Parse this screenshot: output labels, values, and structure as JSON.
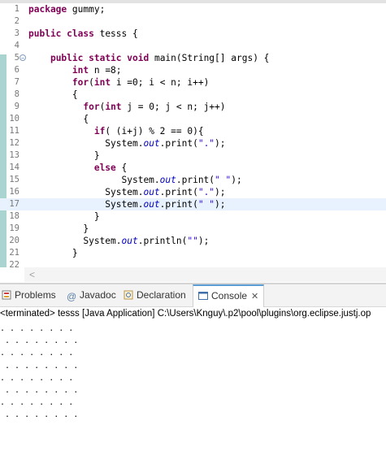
{
  "editor": {
    "lines": [
      {
        "n": "1",
        "segments": [
          {
            "t": "package ",
            "c": "kw"
          },
          {
            "t": "gummy;",
            "c": "id"
          }
        ]
      },
      {
        "n": "2",
        "segments": []
      },
      {
        "n": "3",
        "segments": [
          {
            "t": "public ",
            "c": "kw"
          },
          {
            "t": "class ",
            "c": "kw"
          },
          {
            "t": "tesss {",
            "c": "id"
          }
        ]
      },
      {
        "n": "4",
        "segments": []
      },
      {
        "n": "5",
        "fold": true,
        "segments": [
          {
            "t": "    ",
            "c": "id"
          },
          {
            "t": "public ",
            "c": "kw"
          },
          {
            "t": "static ",
            "c": "kw"
          },
          {
            "t": "void ",
            "c": "kw"
          },
          {
            "t": "main(String[] args) {",
            "c": "id"
          }
        ]
      },
      {
        "n": "6",
        "segments": [
          {
            "t": "        ",
            "c": "id"
          },
          {
            "t": "int ",
            "c": "kw"
          },
          {
            "t": "n =8;",
            "c": "id"
          }
        ]
      },
      {
        "n": "7",
        "segments": [
          {
            "t": "        ",
            "c": "id"
          },
          {
            "t": "for",
            "c": "kw"
          },
          {
            "t": "(",
            "c": "id"
          },
          {
            "t": "int ",
            "c": "kw"
          },
          {
            "t": "i =0; i < n; i++)",
            "c": "id"
          }
        ]
      },
      {
        "n": "8",
        "segments": [
          {
            "t": "        {",
            "c": "id"
          }
        ]
      },
      {
        "n": "9",
        "segments": [
          {
            "t": "          ",
            "c": "id"
          },
          {
            "t": "for",
            "c": "kw"
          },
          {
            "t": "(",
            "c": "id"
          },
          {
            "t": "int ",
            "c": "kw"
          },
          {
            "t": "j = 0; j < n; j++)",
            "c": "id"
          }
        ]
      },
      {
        "n": "10",
        "segments": [
          {
            "t": "          {",
            "c": "id"
          }
        ]
      },
      {
        "n": "11",
        "segments": [
          {
            "t": "            ",
            "c": "id"
          },
          {
            "t": "if",
            "c": "kw"
          },
          {
            "t": "( (i+j) % 2 == 0){",
            "c": "id"
          }
        ]
      },
      {
        "n": "12",
        "segments": [
          {
            "t": "              System.",
            "c": "id"
          },
          {
            "t": "out",
            "c": "fld"
          },
          {
            "t": ".print(",
            "c": "id"
          },
          {
            "t": "\".\"",
            "c": "st"
          },
          {
            "t": ");",
            "c": "id"
          }
        ]
      },
      {
        "n": "13",
        "segments": [
          {
            "t": "            }",
            "c": "id"
          }
        ]
      },
      {
        "n": "14",
        "segments": [
          {
            "t": "            ",
            "c": "id"
          },
          {
            "t": "else",
            "c": "kw"
          },
          {
            "t": " {",
            "c": "id"
          }
        ]
      },
      {
        "n": "15",
        "segments": [
          {
            "t": "                 System.",
            "c": "id"
          },
          {
            "t": "out",
            "c": "fld"
          },
          {
            "t": ".print(",
            "c": "id"
          },
          {
            "t": "\" \"",
            "c": "st"
          },
          {
            "t": ");",
            "c": "id"
          }
        ]
      },
      {
        "n": "16",
        "segments": [
          {
            "t": "              System.",
            "c": "id"
          },
          {
            "t": "out",
            "c": "fld"
          },
          {
            "t": ".print(",
            "c": "id"
          },
          {
            "t": "\".\"",
            "c": "st"
          },
          {
            "t": ");",
            "c": "id"
          }
        ]
      },
      {
        "n": "17",
        "highlight": true,
        "segments": [
          {
            "t": "              System.",
            "c": "id"
          },
          {
            "t": "out",
            "c": "fld"
          },
          {
            "t": ".print(",
            "c": "id"
          },
          {
            "t": "\" \"",
            "c": "st"
          },
          {
            "t": ");",
            "c": "id"
          }
        ]
      },
      {
        "n": "18",
        "segments": [
          {
            "t": "            }",
            "c": "id"
          }
        ]
      },
      {
        "n": "19",
        "segments": [
          {
            "t": "          }",
            "c": "id"
          }
        ]
      },
      {
        "n": "20",
        "segments": [
          {
            "t": "          System.",
            "c": "id"
          },
          {
            "t": "out",
            "c": "fld"
          },
          {
            "t": ".println(",
            "c": "id"
          },
          {
            "t": "\"\"",
            "c": "st"
          },
          {
            "t": ");",
            "c": "id"
          }
        ]
      },
      {
        "n": "21",
        "segments": [
          {
            "t": "        }",
            "c": "id"
          }
        ]
      },
      {
        "n": "22",
        "segments": []
      }
    ],
    "scroll_left": "<"
  },
  "views": {
    "tabs": [
      {
        "name": "tab-problems",
        "icon": "problems-icon",
        "label": "Problems"
      },
      {
        "name": "tab-javadoc",
        "icon": "javadoc-icon",
        "label": "Javadoc"
      },
      {
        "name": "tab-declaration",
        "icon": "declaration-icon",
        "label": "Declaration"
      },
      {
        "name": "tab-console",
        "icon": "console-icon",
        "label": "Console",
        "active": true,
        "close": "✕"
      }
    ],
    "console_header": "<terminated> tesss [Java Application] C:\\Users\\Knguy\\.p2\\pool\\plugins\\org.eclipse.justj.op",
    "output": [
      ". . . . . . . . ",
      " . . . . . . . .",
      ". . . . . . . . ",
      " . . . . . . . .",
      ". . . . . . . . ",
      " . . . . . . . .",
      ". . . . . . . . ",
      " . . . . . . . ."
    ]
  },
  "colors": {
    "keyword": "#7f0055",
    "string": "#2a00ff",
    "field": "#0000c0",
    "current_line": "#e8f2fe",
    "active_tab_accent": "#5c9dd6"
  }
}
